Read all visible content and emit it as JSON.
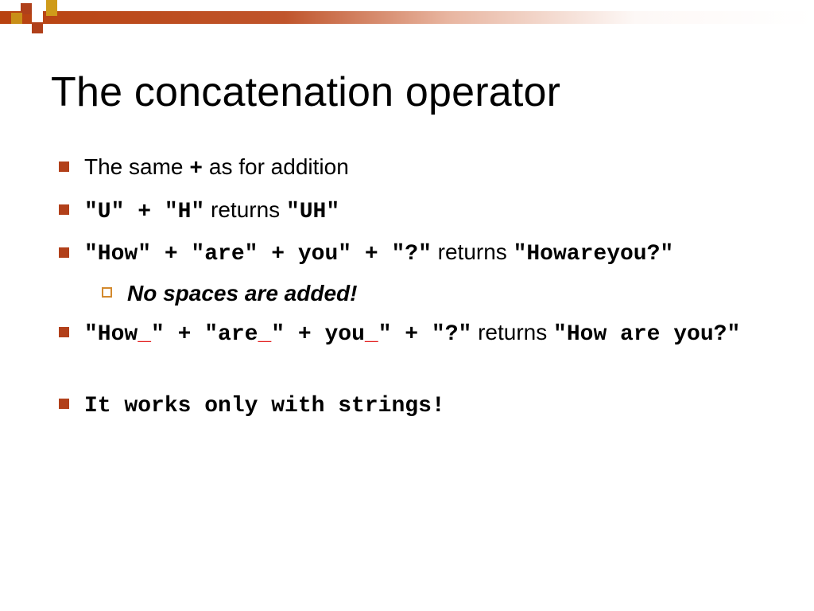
{
  "title": "The concatenation operator",
  "bullets": {
    "b1": {
      "pre": "The same ",
      "plus": "+",
      "post": " as for addition"
    },
    "b2": {
      "code1": "\"U\" + \"H\"",
      "returns": "  returns ",
      "code2": "\"UH\""
    },
    "b3": {
      "code1": "\"How\" + \"are\" + you\" + \"?\"",
      "returns": " returns ",
      "code2": "\"Howareyou?\""
    },
    "sub1": "No spaces are added!",
    "b4": {
      "seg1": "\"How",
      "u1": "_",
      "seg2": "\" + \"are",
      "u2": "_",
      "seg3": "\" + you",
      "u3": "_",
      "seg4": "\" + \"?\"",
      "returns": " returns ",
      "result": "\"How are you?\""
    },
    "b5": "It works only with strings!"
  }
}
